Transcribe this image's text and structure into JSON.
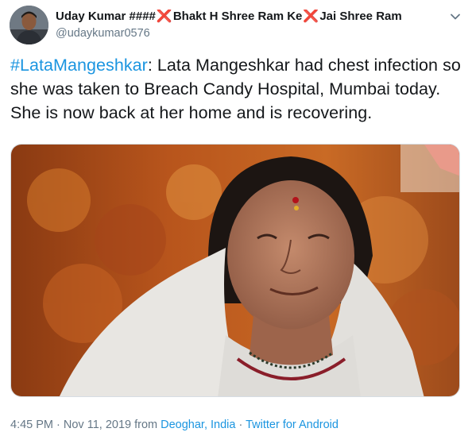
{
  "tweet": {
    "author": {
      "name_part1": "Uday Kumar ####",
      "name_part2": "Bhakt H Shree Ram Ke",
      "name_part3": "Jai Shree Ram",
      "cross_glyph": "❌",
      "handle": "@udaykumar0576"
    },
    "hashtag": "#LataMangeshkar",
    "body": ": Lata Mangeshkar had chest infection so she was taken to Breach Candy Hospital, Mumbai today. She is now back at her home and is recovering.",
    "meta": {
      "time": "4:45 PM",
      "sep1": " · ",
      "date": "Nov 11, 2019",
      "from_text": " from ",
      "location": "Deoghar, India",
      "sep2": " · ",
      "source": "Twitter for Android"
    }
  },
  "colors": {
    "accent": "#1b95e0",
    "cross": "#e0245e",
    "secondary_text": "#657786"
  },
  "icons": {
    "caret": "chevron-down-icon"
  }
}
